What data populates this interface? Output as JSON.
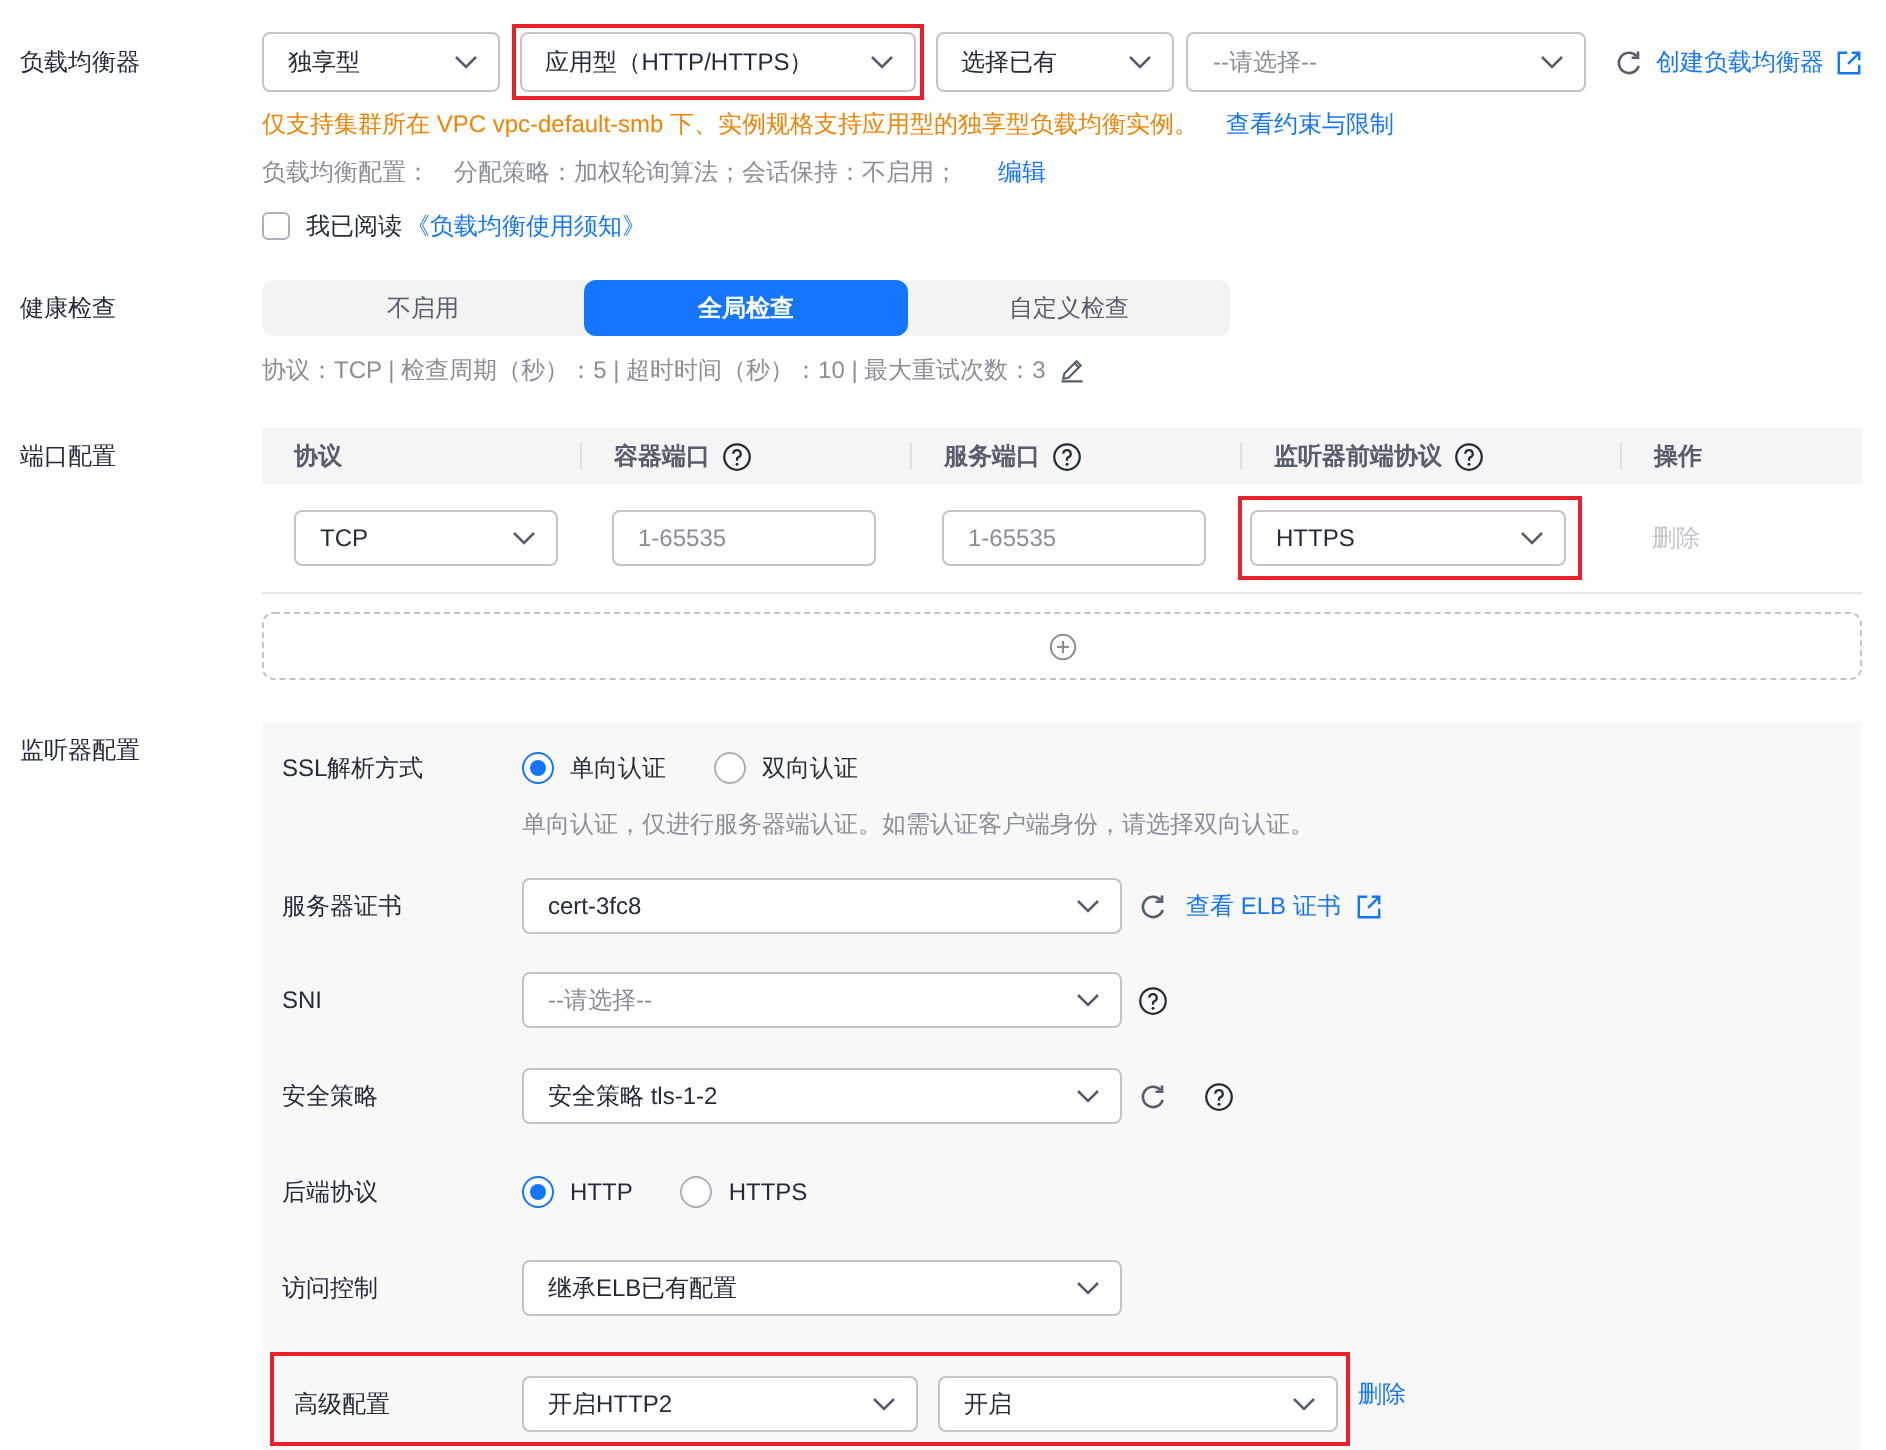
{
  "load_balancer": {
    "label": "负载均衡器",
    "selects": [
      {
        "value": "独享型",
        "highlighted": false
      },
      {
        "value": "应用型（HTTP/HTTPS）",
        "highlighted": true
      },
      {
        "value": "选择已有",
        "highlighted": false
      },
      {
        "placeholder": "--请选择--",
        "highlighted": false
      }
    ],
    "refresh": true,
    "create_link": "创建负载均衡器",
    "warning": "仅支持集群所在 VPC vpc-default-smb 下、实例规格支持应用型的独享型负载均衡实例。",
    "warning_link": "查看约束与限制",
    "config_label": "负载均衡配置：",
    "config_text": "分配策略：加权轮询算法；会话保持：不启用；",
    "edit_link": "编辑",
    "agree": {
      "checked": false,
      "label": "我已阅读",
      "link": "《负载均衡使用须知》"
    }
  },
  "health_check": {
    "label": "健康检查",
    "options": [
      {
        "label": "不启用",
        "selected": false
      },
      {
        "label": "全局检查",
        "selected": true
      },
      {
        "label": "自定义检查",
        "selected": false
      }
    ],
    "detail": "协议：TCP | 检查周期（秒）：5 | 超时时间（秒）：10 | 最大重试次数：3"
  },
  "port_config": {
    "label": "端口配置",
    "columns": [
      {
        "title": "协议",
        "help": false
      },
      {
        "title": "容器端口",
        "help": true
      },
      {
        "title": "服务端口",
        "help": true
      },
      {
        "title": "监听器前端协议",
        "help": true
      },
      {
        "title": "操作",
        "help": false
      }
    ],
    "rows": [
      {
        "protocol": "TCP",
        "container_port": {
          "placeholder": "1-65535"
        },
        "service_port": {
          "placeholder": "1-65535"
        },
        "listener_protocol": {
          "value": "HTTPS",
          "highlighted": true
        },
        "action": {
          "label": "删除",
          "disabled": true
        }
      }
    ]
  },
  "listener": {
    "label": "监听器配置",
    "fields": [
      {
        "kind": "radio",
        "label": "SSL解析方式",
        "options": [
          {
            "label": "单向认证",
            "selected": true
          },
          {
            "label": "双向认证",
            "selected": false
          }
        ],
        "hint": "单向认证，仅进行服务器端认证。如需认证客户端身份，请选择双向认证。"
      },
      {
        "kind": "select",
        "label": "服务器证书",
        "value": "cert-3fc8",
        "refresh": true,
        "help": false,
        "link": "查看 ELB 证书"
      },
      {
        "kind": "select",
        "label": "SNI",
        "placeholder": "--请选择--",
        "refresh": false,
        "help": true
      },
      {
        "kind": "select",
        "label": "安全策略",
        "value": "安全策略 tls-1-2",
        "refresh": true,
        "help": true
      },
      {
        "kind": "radio",
        "label": "后端协议",
        "options": [
          {
            "label": "HTTP",
            "selected": true
          },
          {
            "label": "HTTPS",
            "selected": false
          }
        ]
      },
      {
        "kind": "select",
        "label": "访问控制",
        "value": "继承ELB已有配置",
        "refresh": false,
        "help": false
      },
      {
        "kind": "pair",
        "label": "高级配置",
        "values": [
          "开启HTTP2",
          "开启"
        ],
        "delete": "删除",
        "highlighted": true
      }
    ]
  }
}
